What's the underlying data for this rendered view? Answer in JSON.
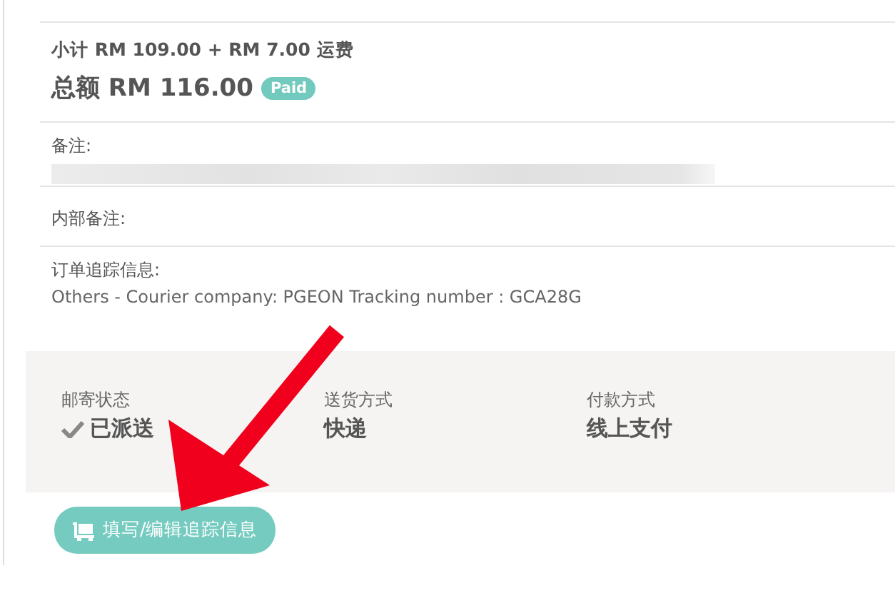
{
  "summary": {
    "subtotal": "小计 RM 109.00 + RM 7.00 运费",
    "total": "总额 RM 116.00",
    "payment_badge": "Paid"
  },
  "fields": [
    {
      "label": "备注:",
      "kind": "redacted"
    },
    {
      "label": "内部备注:",
      "kind": "empty"
    },
    {
      "label": "订单追踪信息:",
      "kind": "text",
      "value": "Others - Courier company: PGEON Tracking number : GCA28G"
    }
  ],
  "status_panel": [
    {
      "label": "邮寄状态",
      "value": "已派送",
      "checked": true
    },
    {
      "label": "送货方式",
      "value": "快递",
      "checked": false
    },
    {
      "label": "付款方式",
      "value": "线上支付",
      "checked": false
    }
  ],
  "tracking_button": {
    "label": "填写/编辑追踪信息"
  }
}
